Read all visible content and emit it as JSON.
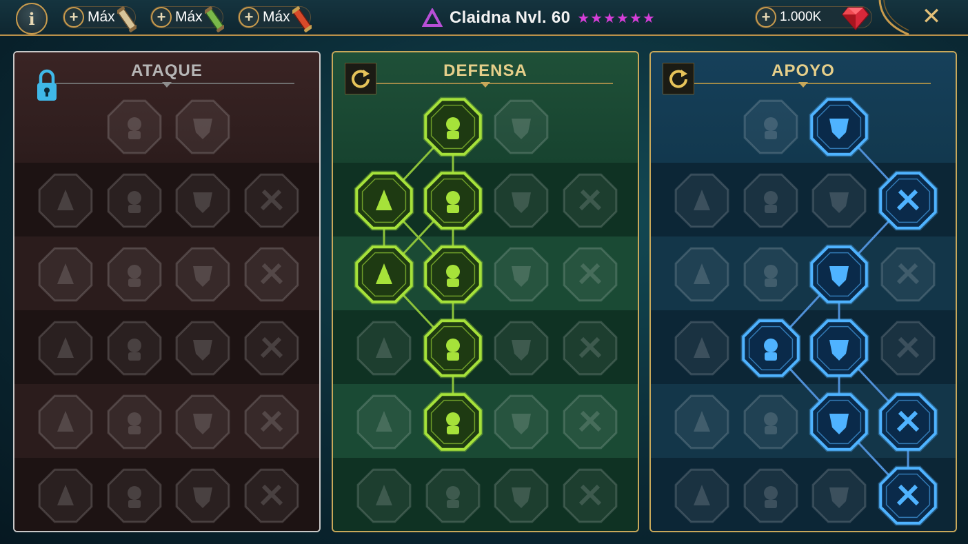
{
  "topbar": {
    "info_label": "i",
    "resources": [
      {
        "label": "Máx",
        "scroll_color": "#d8c59a"
      },
      {
        "label": "Máx",
        "scroll_color": "#7ab84a"
      },
      {
        "label": "Máx",
        "scroll_color": "#d84a2a"
      }
    ],
    "champion_title": "Claidna Nvl. 60",
    "stars": "★★★★★★",
    "gems": "1.000K",
    "close_label": "✕"
  },
  "panels": {
    "attack": {
      "title": "ATAQUE"
    },
    "defense": {
      "title": "DEFENSA"
    },
    "support": {
      "title": "APOYO"
    }
  },
  "colors": {
    "attack_bg": "#2a1a1a",
    "defense_bg": "#123a2a",
    "support_bg": "#0e2a3a",
    "defense_active": "#a6e23a",
    "support_active": "#4fb3ff",
    "gold": "#c89b4d",
    "star": "#d63ed8"
  },
  "skill_tree": {
    "attack": {
      "active": [],
      "rows": [
        [
          "",
          "crossed-swords-icon",
          "daggers-icon",
          ""
        ],
        [
          "horned-demon-icon",
          "cleave-icon",
          "shield-strike-icon",
          "broken-heart-icon"
        ],
        [
          "arrow-volley-icon",
          "fangs-icon",
          "skull-slash-icon",
          "blade-fist-icon"
        ],
        [
          "poison-heart-icon",
          "power-fist-icon",
          "axe-icon",
          "chain-lightning-icon"
        ],
        [
          "spear-burst-icon",
          "triple-skull-icon",
          "sword-vortex-icon",
          "berserker-icon"
        ],
        [
          "sparkle-sword-icon",
          "knight-helm-icon",
          "demon-lord-icon",
          "skull-cross-icon"
        ]
      ]
    },
    "defense": {
      "active": [
        "0-1",
        "1-0",
        "1-1",
        "2-0",
        "2-1",
        "3-1",
        "4-1"
      ],
      "rows": [
        [
          "",
          "stone-wall-icon",
          "raised-fist-icon",
          ""
        ],
        [
          "chevron-shield-icon",
          "armored-heart-icon",
          "guardian-icon",
          "broken-blade-icon"
        ],
        [
          "dodge-icon",
          "knight-shield-icon",
          "dark-heart-icon",
          "hooded-figure-icon"
        ],
        [
          "crowd-icon",
          "hourglass-icon",
          "open-hand-icon",
          "bull-icon"
        ],
        [
          "speed-runner-icon",
          "triple-drop-icon",
          "skull-ring-icon",
          "slash-icon"
        ],
        [
          "torch-bearer-icon",
          "large-shield-icon",
          "dwarf-warrior-icon",
          "strongman-icon"
        ]
      ]
    },
    "support": {
      "active": [
        "0-2",
        "1-3",
        "2-2",
        "3-1",
        "3-2",
        "4-2",
        "4-3",
        "5-3"
      ],
      "rows": [
        [
          "",
          "healing-heart-icon",
          "eye-of-power-icon",
          ""
        ],
        [
          "praying-hands-icon",
          "aegis-icon",
          "skull-smoke-icon",
          "speed-arrow-icon"
        ],
        [
          "sparkle-figure-icon",
          "lightning-shield-icon",
          "broken-ground-icon",
          "shadow-figure-icon"
        ],
        [
          "chained-heart-icon",
          "comet-icon",
          "spellbook-icon",
          "eyes-in-dark-icon"
        ],
        [
          "compass-icon",
          "winged-boot-icon",
          "all-seeing-eye-icon",
          "voodoo-icon"
        ],
        [
          "potion-icon",
          "skull-mask-icon",
          "crushing-fist-icon",
          "eagle-icon"
        ]
      ]
    }
  }
}
